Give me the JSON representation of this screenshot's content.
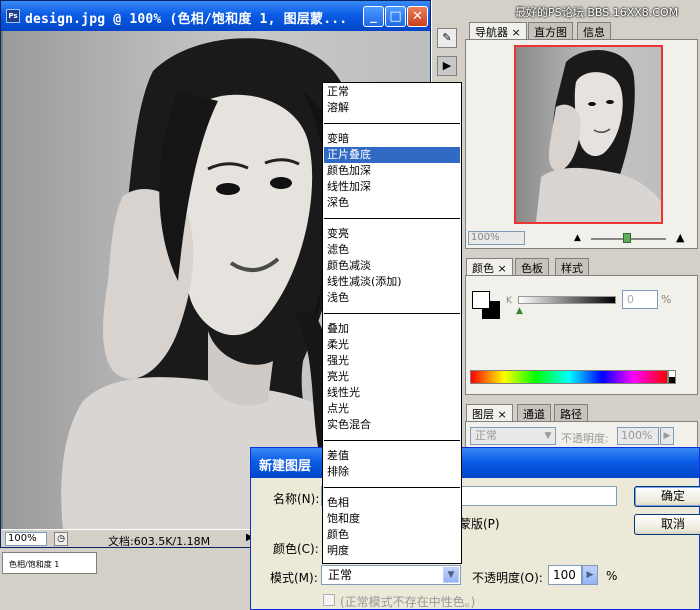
{
  "document": {
    "title": "design.jpg @ 100% (色相/饱和度 1, 图层蒙...",
    "zoom": "100%",
    "doc_info": "文档:603.5K/1.18M",
    "layer_label": "色相/饱和度 1"
  },
  "watermark": "最好的PS论坛:BBS.16XX8.COM",
  "navigator": {
    "tabs": [
      "导航器 ×",
      "直方图",
      "信息"
    ],
    "zoom": "100%"
  },
  "color_panel": {
    "tabs": [
      "颜色 ×",
      "色板",
      "样式"
    ],
    "channel": "K",
    "value": "0",
    "unit": "%",
    "colors": {
      "foreground": "#ffffff",
      "background": "#000000"
    }
  },
  "layers_panel": {
    "tabs": [
      "图层 ×",
      "通道",
      "路径"
    ],
    "mode": "正常",
    "opacity_label": "不透明度:",
    "opacity": "100%"
  },
  "dialog": {
    "title": "新建图层",
    "name_label": "名称(N):",
    "color_label": "颜色(C):",
    "mode_label": "模式(M):",
    "mode_value": "正常",
    "mask_text": "蒙版(P)",
    "opacity_label": "不透明度(O):",
    "opacity_value": "100",
    "opacity_unit": "%",
    "neutral_text": "(正常模式不存在中性色。)",
    "ok": "确定",
    "cancel": "取消"
  },
  "blend_modes": {
    "selected": "正片叠底",
    "groups": [
      [
        "正常",
        "溶解"
      ],
      [
        "变暗",
        "正片叠底",
        "颜色加深",
        "线性加深",
        "深色"
      ],
      [
        "变亮",
        "滤色",
        "颜色减淡",
        "线性减淡(添加)",
        "浅色"
      ],
      [
        "叠加",
        "柔光",
        "强光",
        "亮光",
        "线性光",
        "点光",
        "实色混合"
      ],
      [
        "差值",
        "排除"
      ],
      [
        "色相",
        "饱和度",
        "颜色",
        "明度"
      ]
    ]
  }
}
